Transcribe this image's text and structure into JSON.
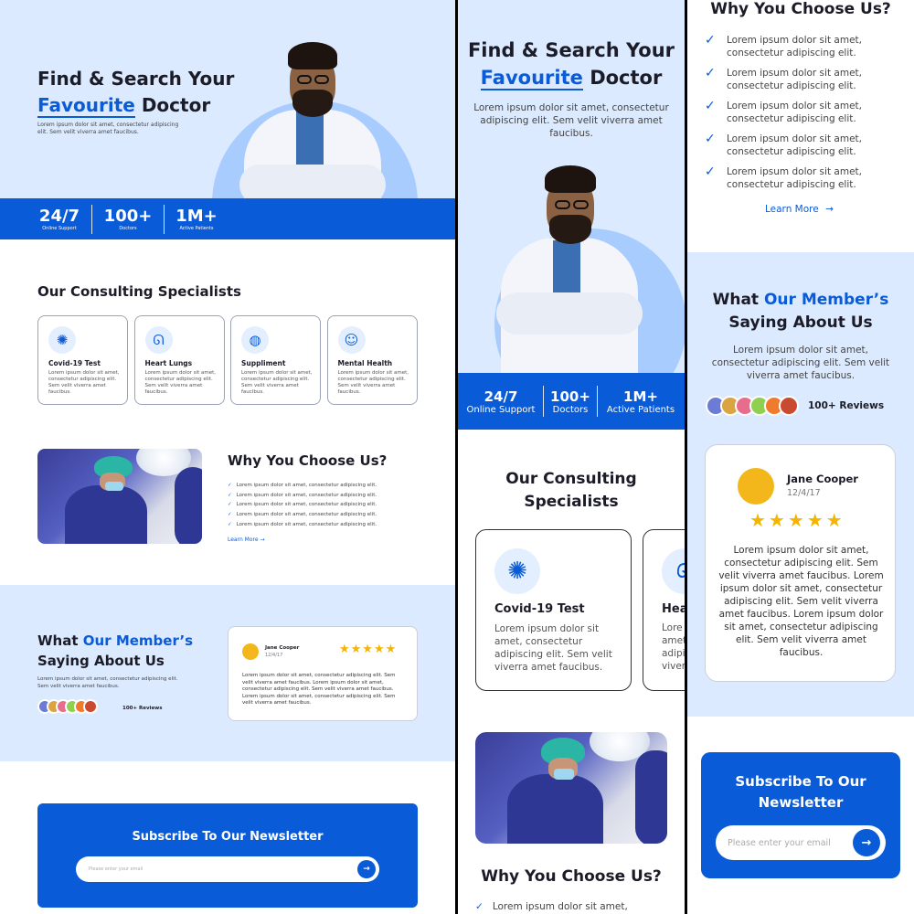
{
  "hero": {
    "title_line1": "Find & Search Your",
    "title_highlight": "Favourite",
    "title_rest": "Doctor",
    "description": "Lorem ipsum dolor sit amet, consectetur adipiscing elit. Sem velit viverra amet faucibus."
  },
  "stats": [
    {
      "value": "24/7",
      "label": "Online Support"
    },
    {
      "value": "100+",
      "label": "Doctors"
    },
    {
      "value": "1M+",
      "label": "Active Patients"
    }
  ],
  "specialists": {
    "heading": "Our Consulting Specialists",
    "cards": [
      {
        "title": "Covid-19 Test",
        "icon": "virus-icon",
        "text": "Lorem ipsum dolor sit amet, consectetur adipiscing elit. Sem velit viverra amet faucibus."
      },
      {
        "title": "Heart Lungs",
        "icon": "lungs-icon",
        "text": "Lorem ipsum dolor sit amet, consectetur adipiscing elit. Sem velit viverra amet faucibus."
      },
      {
        "title": "Suppliment",
        "icon": "bowl-icon",
        "text": "Lorem ipsum dolor sit amet, consectetur adipiscing elit. Sem velit viverra amet faucibus."
      },
      {
        "title": "Mental Health",
        "icon": "head-icon",
        "text": "Lorem ipsum dolor sit amet, consectetur adipiscing elit. Sem velit viverra amet faucibus."
      }
    ],
    "mobile_card2_partial": [
      "Hea",
      "Lore",
      "amet",
      "adipi",
      "viver"
    ]
  },
  "why": {
    "heading": "Why You Choose Us?",
    "items": [
      "Lorem ipsum dolor sit amet, consectetur adipiscing elit.",
      "Lorem ipsum dolor sit amet, consectetur adipiscing elit.",
      "Lorem ipsum dolor sit amet, consectetur adipiscing elit.",
      "Lorem ipsum dolor sit amet, consectetur adipiscing elit.",
      "Lorem ipsum dolor sit amet, consectetur adipiscing elit."
    ],
    "mobile_item_line1": "Lorem ipsum dolor sit amet,",
    "mobile_item_line2": "consectetur adipiscing elit.",
    "learn_more": "Learn More",
    "arrow": "→"
  },
  "testimonials": {
    "heading_pre": "What",
    "heading_highlight": "Our Member’s",
    "heading_line2": "Saying About Us",
    "description": "Lorem ipsum dolor sit amet, consectetur adipiscing elit. Sem velit viverra amet faucibus.",
    "reviews_count": "100+ Reviews",
    "review": {
      "name": "Jane Cooper",
      "date": "12/4/17",
      "stars": 5,
      "star_char": "★★★★★",
      "text": "Lorem ipsum dolor sit amet, consectetur adipiscing elit. Sem velit viverra amet faucibus. Lorem ipsum dolor sit amet, consectetur adipiscing elit. Sem velit viverra amet faucibus. Lorem ipsum dolor sit amet, consectetur adipiscing elit. Sem velit viverra amet faucibus."
    },
    "avatar_colors": [
      "#6b7bd6",
      "#d9a441",
      "#e86c8c",
      "#8fd14f",
      "#f07b2c",
      "#c94a2e"
    ]
  },
  "newsletter": {
    "heading": "Subscribe To Our Newsletter",
    "heading_line1": "Subscribe To Our",
    "heading_line2": "Newsletter",
    "placeholder": "Please enter your email",
    "submit": "→"
  },
  "colors": {
    "accent": "#0a5bd8",
    "hero_bg": "#dceaff",
    "star": "#f5b400"
  }
}
